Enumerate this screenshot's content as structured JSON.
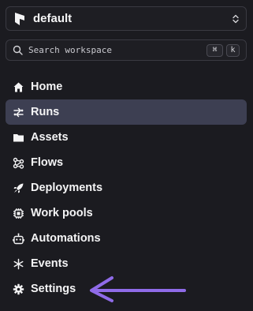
{
  "workspace": {
    "name": "default",
    "logo_icon": "prefect-logo-icon",
    "chevron_icon": "chevron-up-down-icon"
  },
  "search": {
    "placeholder": "Search workspace",
    "shortcut_modifier": "⌘",
    "shortcut_key": "k",
    "icon": "search-icon"
  },
  "nav": {
    "active": "Runs",
    "active_color": "#3d3f52",
    "items": [
      {
        "label": "Home",
        "icon": "home-icon"
      },
      {
        "label": "Runs",
        "icon": "runs-icon"
      },
      {
        "label": "Assets",
        "icon": "folder-icon"
      },
      {
        "label": "Flows",
        "icon": "flows-icon"
      },
      {
        "label": "Deployments",
        "icon": "rocket-icon"
      },
      {
        "label": "Work pools",
        "icon": "chip-icon"
      },
      {
        "label": "Automations",
        "icon": "robot-icon"
      },
      {
        "label": "Events",
        "icon": "asterisk-icon"
      },
      {
        "label": "Settings",
        "icon": "gear-icon"
      }
    ]
  },
  "annotation": {
    "arrow_color": "#8f6be8",
    "points_to": "Settings"
  }
}
